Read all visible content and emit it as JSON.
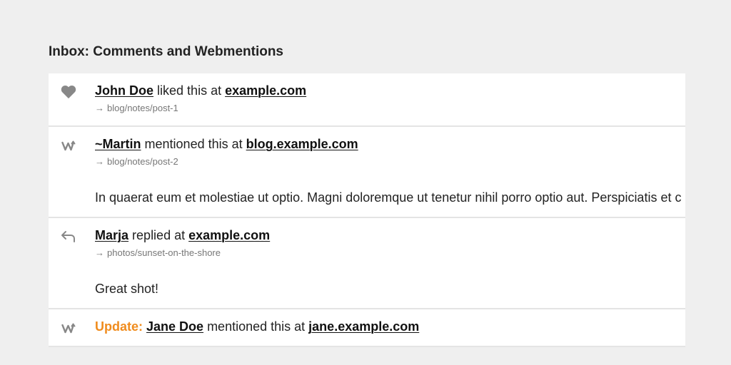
{
  "inbox": {
    "title": "Inbox: Comments and Webmentions"
  },
  "colors": {
    "background": "#efefef",
    "card": "#ffffff",
    "update_accent": "#f08c1e",
    "icon": "#888888"
  },
  "items": [
    {
      "icon": "heart-icon",
      "author": "John Doe",
      "verb": "liked this at",
      "site": "example.com",
      "arrow": "→",
      "path": "blog/notes/post-1",
      "content": ""
    },
    {
      "icon": "webmention-icon",
      "author": "~Martin",
      "verb": "mentioned this at",
      "site": "blog.example.com",
      "arrow": "→",
      "path": "blog/notes/post-2",
      "content": "In quaerat eum et molestiae ut optio. Magni doloremque ut tenetur nihil porro optio aut. Perspiciatis et c"
    },
    {
      "icon": "reply-icon",
      "author": "Marja",
      "verb": "replied at",
      "site": "example.com",
      "arrow": "→",
      "path": "photos/sunset-on-the-shore",
      "content": "Great shot!"
    },
    {
      "icon": "webmention-icon",
      "update_label": "Update:",
      "author": "Jane Doe",
      "verb": "mentioned this at",
      "site": "jane.example.com"
    }
  ]
}
